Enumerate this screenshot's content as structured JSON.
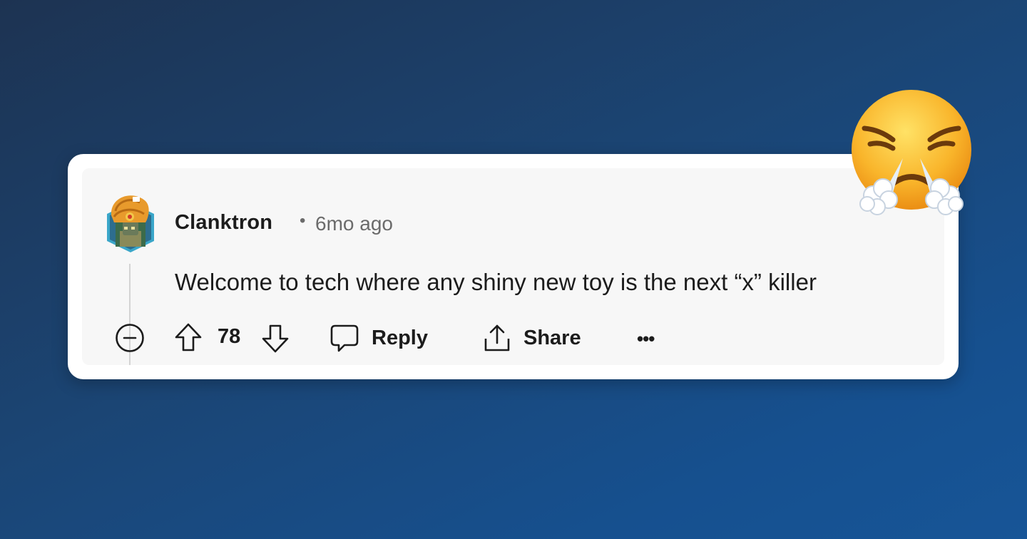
{
  "comment": {
    "author": "Clanktron",
    "separator": "•",
    "timestamp": "6mo ago",
    "body": "Welcome to tech where any shiny new toy is the next “x” killer"
  },
  "actions": {
    "vote_count": "78",
    "reply_label": "Reply",
    "share_label": "Share",
    "more_label": "•••"
  },
  "icons": {
    "collapse": "minus-circle-icon",
    "upvote": "arrow-up-icon",
    "downvote": "arrow-down-icon",
    "reply": "speech-bubble-icon",
    "share": "upload-share-icon",
    "reaction": "face-with-steam-from-nose-emoji"
  },
  "colors": {
    "background_start": "#1d3352",
    "background_end": "#175597",
    "card": "#ffffff",
    "comment_bg": "#f7f7f7",
    "text": "#1c1c1c",
    "meta": "#6b6b6b"
  }
}
